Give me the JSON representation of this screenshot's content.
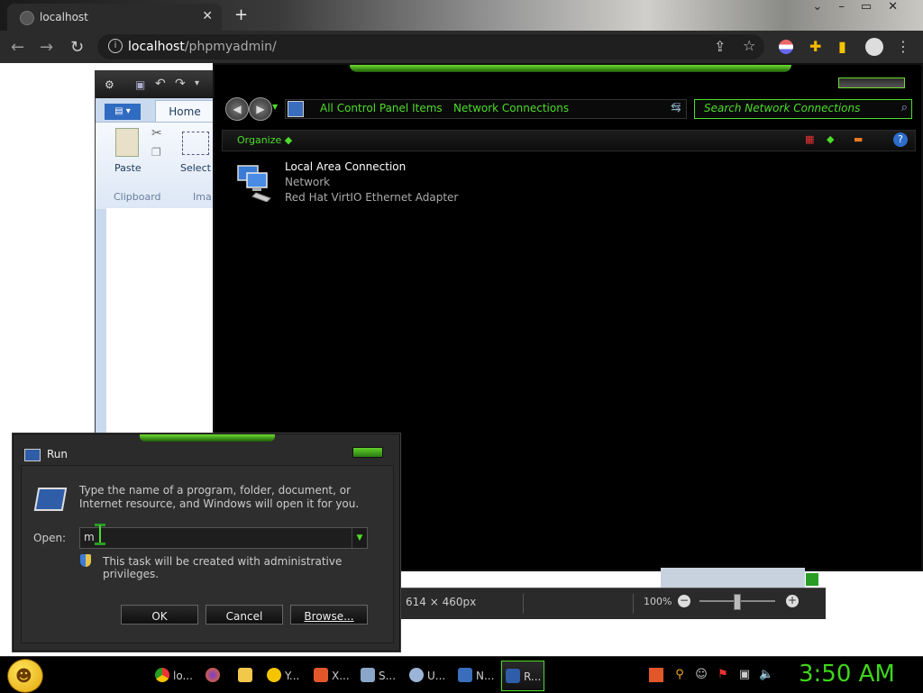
{
  "browser": {
    "tab_title": "localhost",
    "url_host": "localhost",
    "url_path": "/phpmyadmin/"
  },
  "paint": {
    "home_tab": "Home",
    "paste_label": "Paste",
    "select_label": "Select",
    "clipboard_group": "Clipboard",
    "image_group_partial": "Ima",
    "status_dimensions": "614 × 460px",
    "zoom_level": "100%"
  },
  "network_connections": {
    "breadcrumb": [
      "All Control Panel Items",
      "Network Connections"
    ],
    "search_placeholder": "Search Network Connections",
    "organize_label": "Organize",
    "connection": {
      "name": "Local Area Connection",
      "network": "Network",
      "adapter": "Red Hat VirtIO Ethernet Adapter"
    }
  },
  "run_dialog": {
    "title": "Run",
    "description": "Type the name of a program, folder, document, or Internet resource, and Windows will open it for you.",
    "open_label": "Open:",
    "open_value": "m",
    "admin_note": "This task will be created with administrative privileges.",
    "ok_label": "OK",
    "cancel_label": "Cancel",
    "browse_label": "Browse..."
  },
  "taskbar": {
    "items": [
      {
        "label": "lo...",
        "icon": "chrome-icon"
      },
      {
        "label": "",
        "icon": "firefox-icon"
      },
      {
        "label": "",
        "icon": "folder-icon"
      },
      {
        "label": "Y...",
        "icon": "smiley-app-icon"
      },
      {
        "label": "X...",
        "icon": "xampp-icon"
      },
      {
        "label": "S...",
        "icon": "services-icon"
      },
      {
        "label": "U...",
        "icon": "paint-icon"
      },
      {
        "label": "N...",
        "icon": "network-icon"
      },
      {
        "label": "R...",
        "icon": "run-icon"
      }
    ],
    "clock": "3:50 AM"
  },
  "colors": {
    "accent_green": "#4ddc2a",
    "clock_green": "#3ed51c"
  }
}
